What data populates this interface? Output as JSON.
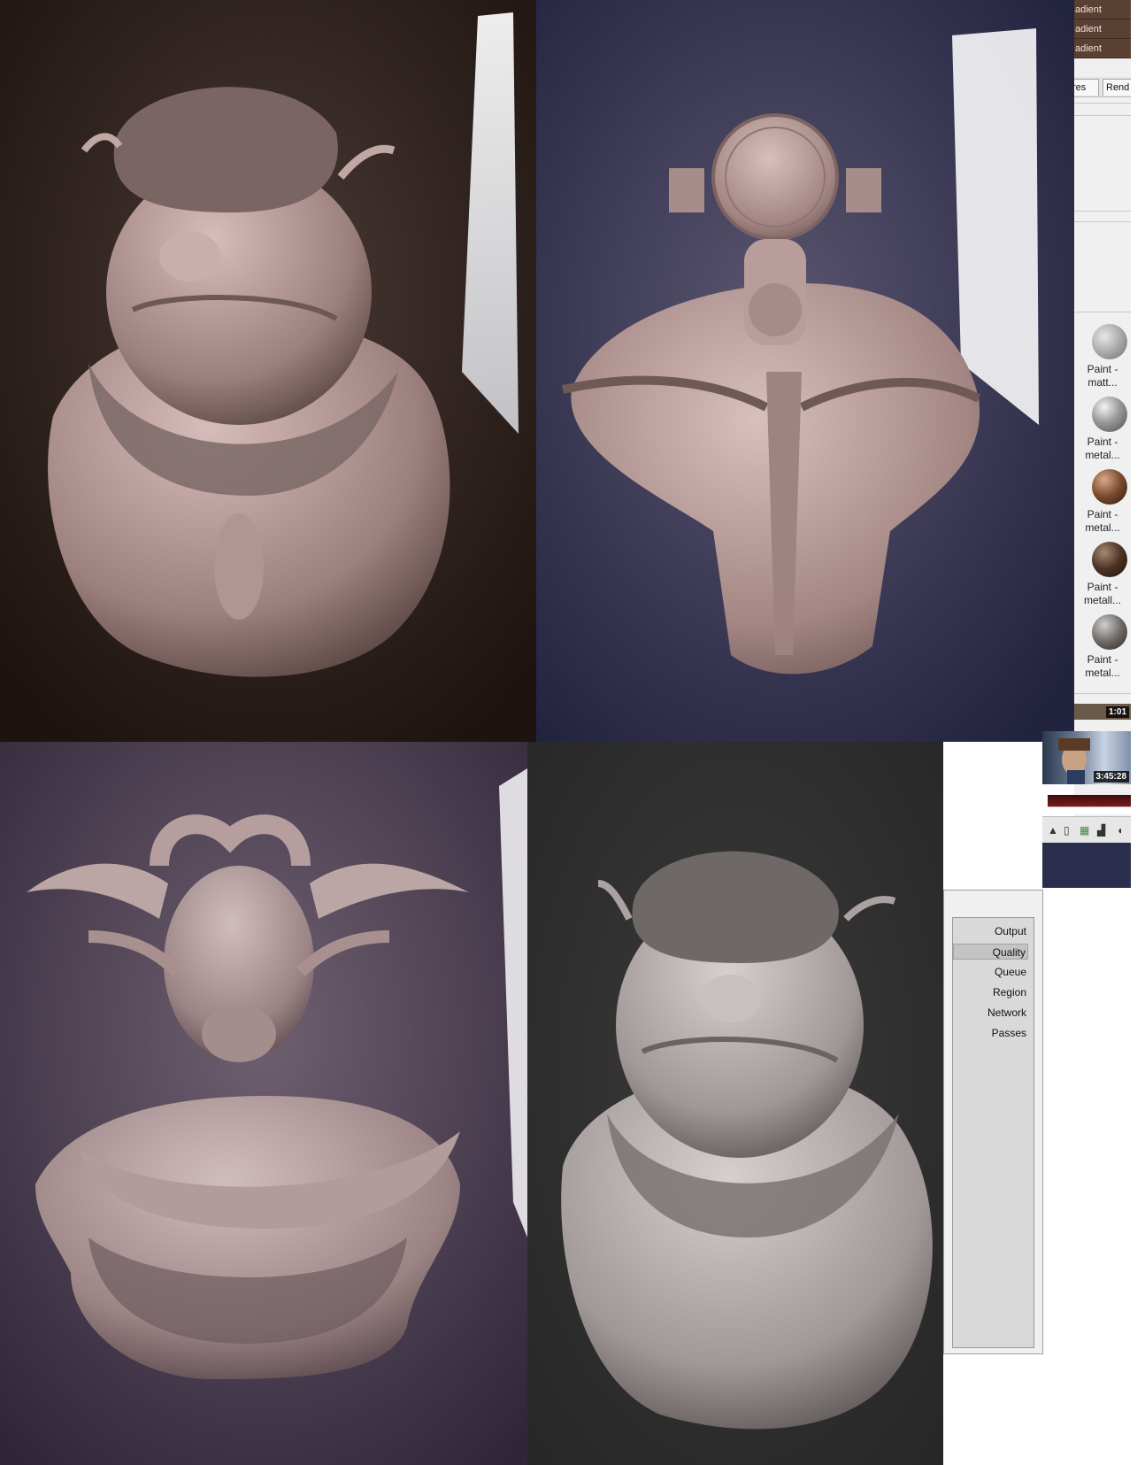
{
  "side_panel": {
    "gradient_rows": [
      "adient",
      "adient",
      "adient"
    ],
    "tabs": [
      "res",
      "Rend"
    ],
    "materials": [
      {
        "label_1": "Paint -",
        "label_2": "matt...",
        "icon": "gray-matte-sphere-icon"
      },
      {
        "label_1": "Paint -",
        "label_2": "metal...",
        "icon": "gray-metal-sphere-icon"
      },
      {
        "label_1": "Paint -",
        "label_2": "metal...",
        "icon": "brown-metal-sphere-icon"
      },
      {
        "label_1": "Paint -",
        "label_2": "metall...",
        "icon": "dark-brown-sphere-icon"
      },
      {
        "label_1": "Paint -",
        "label_2": "metal...",
        "icon": "dark-gray-sphere-icon"
      }
    ]
  },
  "videos": [
    {
      "duration": "1:01"
    },
    {
      "duration": "3:45:28"
    }
  ],
  "render_menu": {
    "items": [
      "Output",
      "Quality",
      "Queue",
      "Region",
      "Network",
      "Passes"
    ],
    "selected": "Quality"
  },
  "colors": {
    "render1_bg": "#2a1c16",
    "render2_bg": "#33345a",
    "render3_bg": "#4a3e52",
    "render4_bg": "#2e2e2e",
    "sculpt_pink": "#b79a98",
    "sculpt_gray": "#a8a19f"
  }
}
